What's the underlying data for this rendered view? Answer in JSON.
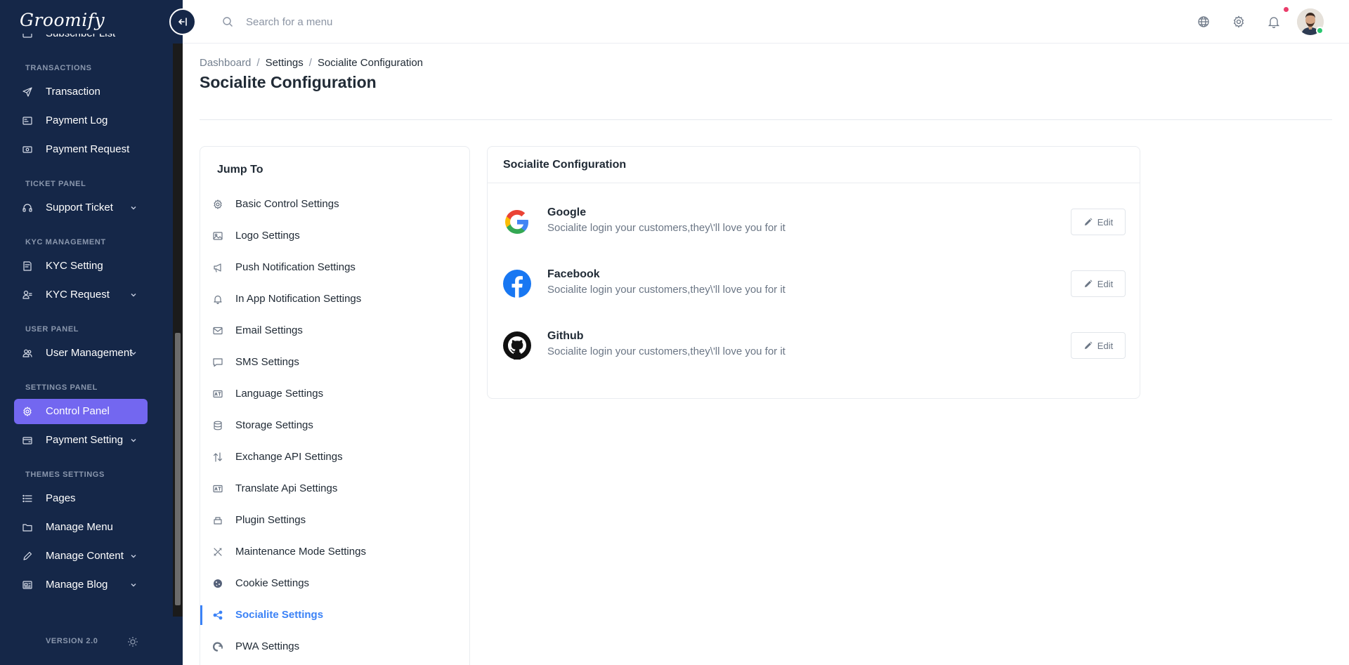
{
  "app": {
    "logo_text": "Groomify"
  },
  "sidebar": {
    "sections": [
      {
        "label": "",
        "items": [
          {
            "label": "Subscriber List",
            "icon": "subscriber-icon",
            "has_chevron": false
          }
        ]
      },
      {
        "label": "TRANSACTIONS",
        "items": [
          {
            "label": "Transaction",
            "icon": "send-icon",
            "has_chevron": false
          },
          {
            "label": "Payment Log",
            "icon": "payment-log-icon",
            "has_chevron": false
          },
          {
            "label": "Payment Request",
            "icon": "money-icon",
            "has_chevron": false
          }
        ]
      },
      {
        "label": "TICKET PANEL",
        "items": [
          {
            "label": "Support Ticket",
            "icon": "headset-icon",
            "has_chevron": true
          }
        ]
      },
      {
        "label": "KYC MANAGEMENT",
        "items": [
          {
            "label": "KYC Setting",
            "icon": "kyc-setting-icon",
            "has_chevron": false
          },
          {
            "label": "KYC Request",
            "icon": "user-check-icon",
            "has_chevron": true
          }
        ]
      },
      {
        "label": "USER PANEL",
        "items": [
          {
            "label": "User Management",
            "icon": "users-icon",
            "has_chevron": true
          }
        ]
      },
      {
        "label": "SETTINGS PANEL",
        "items": [
          {
            "label": "Control Panel",
            "icon": "gear-icon",
            "has_chevron": false,
            "active": true
          },
          {
            "label": "Payment Setting",
            "icon": "wallet-icon",
            "has_chevron": true
          }
        ]
      },
      {
        "label": "THEMES SETTINGS",
        "items": [
          {
            "label": "Pages",
            "icon": "list-icon",
            "has_chevron": false
          },
          {
            "label": "Manage Menu",
            "icon": "folder-icon",
            "has_chevron": false
          },
          {
            "label": "Manage Content",
            "icon": "pencil-icon",
            "has_chevron": true
          },
          {
            "label": "Manage Blog",
            "icon": "newspaper-icon",
            "has_chevron": true
          }
        ]
      }
    ],
    "version": "VERSION 2.0"
  },
  "topbar": {
    "search_placeholder": "Search for a menu"
  },
  "breadcrumb": {
    "items": [
      "Dashboard",
      "Settings",
      "Socialite Configuration"
    ]
  },
  "page": {
    "title": "Socialite Configuration"
  },
  "jump_to": {
    "title": "Jump To",
    "items": [
      {
        "label": "Basic Control Settings",
        "icon": "gear-icon"
      },
      {
        "label": "Logo Settings",
        "icon": "image-icon"
      },
      {
        "label": "Push Notification Settings",
        "icon": "megaphone-icon"
      },
      {
        "label": "In App Notification Settings",
        "icon": "bell-icon"
      },
      {
        "label": "Email Settings",
        "icon": "envelope-icon"
      },
      {
        "label": "SMS Settings",
        "icon": "chat-icon"
      },
      {
        "label": "Language Settings",
        "icon": "translate-icon"
      },
      {
        "label": "Storage Settings",
        "icon": "database-icon"
      },
      {
        "label": "Exchange API Settings",
        "icon": "arrows-up-down-icon"
      },
      {
        "label": "Translate Api Settings",
        "icon": "translate-icon"
      },
      {
        "label": "Plugin Settings",
        "icon": "plugin-icon"
      },
      {
        "label": "Maintenance Mode Settings",
        "icon": "tools-icon"
      },
      {
        "label": "Cookie Settings",
        "icon": "cookie-icon"
      },
      {
        "label": "Socialite Settings",
        "icon": "share-icon",
        "active": true
      },
      {
        "label": "PWA Settings",
        "icon": "pwa-icon"
      }
    ]
  },
  "socialite": {
    "title": "Socialite Configuration",
    "edit_label": "Edit",
    "providers": [
      {
        "name": "Google",
        "description": "Socialite login your customers,they\\'ll love you for it",
        "icon": "google-icon"
      },
      {
        "name": "Facebook",
        "description": "Socialite login your customers,they\\'ll love you for it",
        "icon": "facebook-icon"
      },
      {
        "name": "Github",
        "description": "Socialite login your customers,they\\'ll love you for it",
        "icon": "github-icon"
      }
    ]
  },
  "colors": {
    "sidebar_bg": "#152748",
    "accent": "#7367f0",
    "link_active": "#3b82f6",
    "notification_dot": "#ea3d6b",
    "online": "#28c76f"
  }
}
